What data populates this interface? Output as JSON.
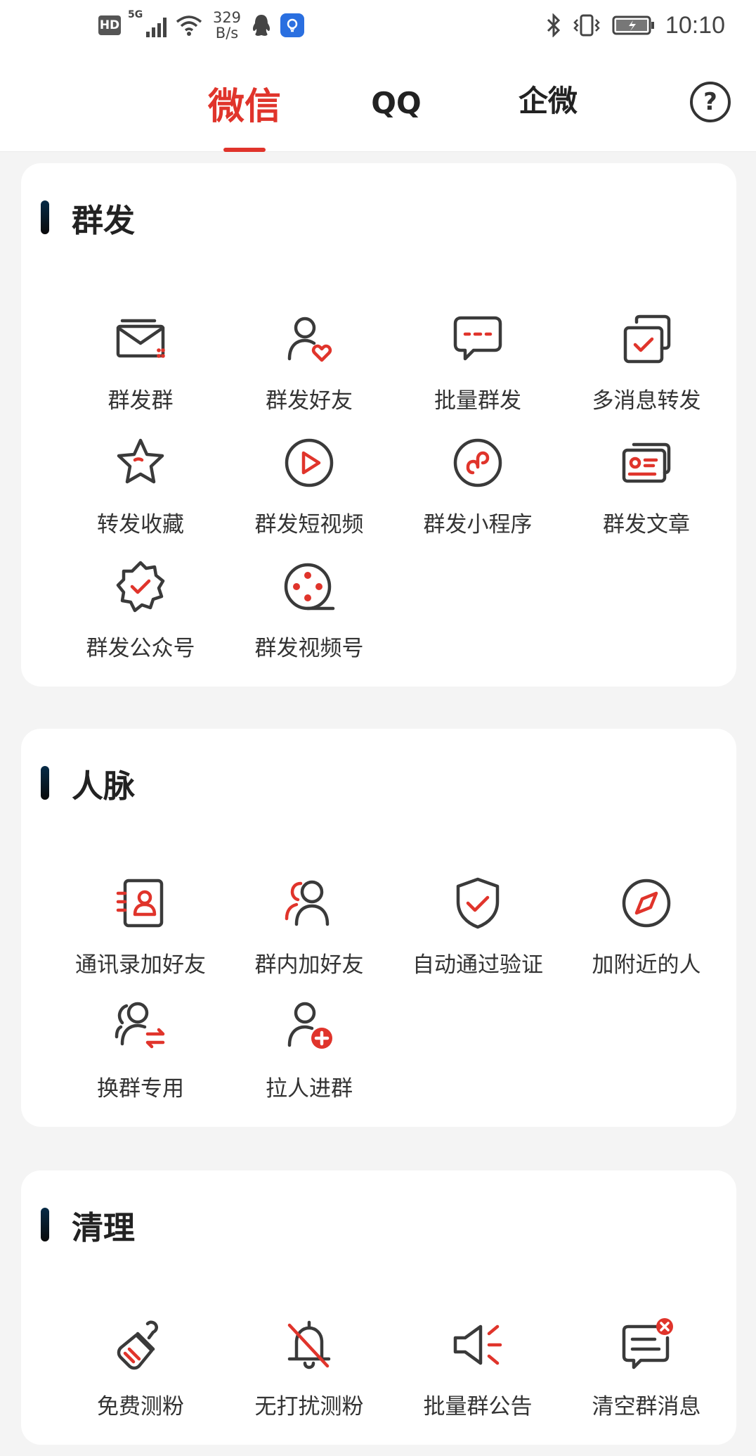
{
  "status_bar": {
    "hd": "HD",
    "network": "5G",
    "net_speed_value": "329",
    "net_speed_unit": "B/s",
    "time": "10:10"
  },
  "tabs": [
    {
      "label": "微信",
      "active": true
    },
    {
      "label": "QQ",
      "active": false
    },
    {
      "label": "企微",
      "active": false
    }
  ],
  "help": "?",
  "accent_color": "#e0342b",
  "sections": [
    {
      "title": "群发",
      "items": [
        {
          "label": "群发群",
          "icon": "mail-icon"
        },
        {
          "label": "群发好友",
          "icon": "user-heart-icon"
        },
        {
          "label": "批量群发",
          "icon": "chat-bubble-icon"
        },
        {
          "label": "多消息转发",
          "icon": "multi-message-icon"
        },
        {
          "label": "转发收藏",
          "icon": "star-icon"
        },
        {
          "label": "群发短视频",
          "icon": "play-icon"
        },
        {
          "label": "群发小程序",
          "icon": "mini-program-icon"
        },
        {
          "label": "群发文章",
          "icon": "article-icon"
        },
        {
          "label": "群发公众号",
          "icon": "badge-check-icon"
        },
        {
          "label": "群发视频号",
          "icon": "film-reel-icon"
        }
      ]
    },
    {
      "title": "人脉",
      "items": [
        {
          "label": "通讯录加好友",
          "icon": "contacts-icon"
        },
        {
          "label": "群内加好友",
          "icon": "users-icon"
        },
        {
          "label": "自动通过验证",
          "icon": "shield-check-icon"
        },
        {
          "label": "加附近的人",
          "icon": "compass-icon"
        },
        {
          "label": "换群专用",
          "icon": "user-swap-icon"
        },
        {
          "label": "拉人进群",
          "icon": "user-add-icon"
        }
      ]
    },
    {
      "title": "清理",
      "items": [
        {
          "label": "免费测粉",
          "icon": "brush-icon"
        },
        {
          "label": "无打扰测粉",
          "icon": "bell-off-icon"
        },
        {
          "label": "批量群公告",
          "icon": "megaphone-icon"
        },
        {
          "label": "清空群消息",
          "icon": "message-clear-icon"
        }
      ]
    }
  ]
}
